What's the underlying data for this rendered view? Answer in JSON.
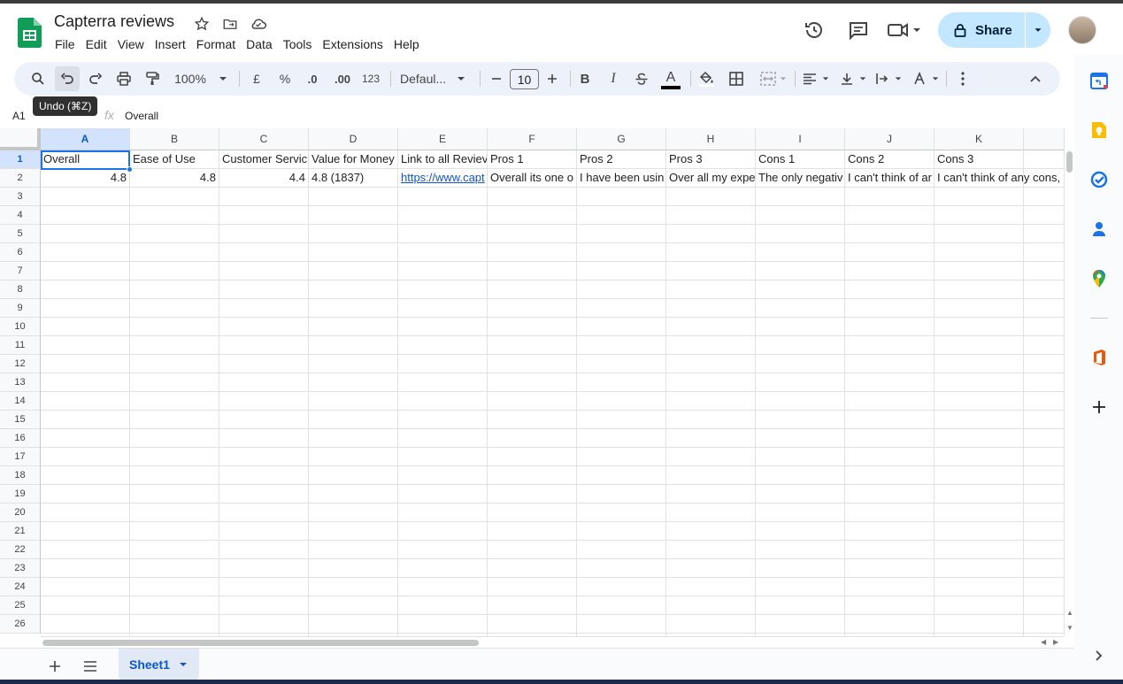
{
  "document": {
    "title": "Capterra reviews"
  },
  "menu": [
    "File",
    "Edit",
    "View",
    "Insert",
    "Format",
    "Data",
    "Tools",
    "Extensions",
    "Help"
  ],
  "header": {
    "share_label": "Share"
  },
  "toolbar": {
    "zoom": "100%",
    "currency": "£",
    "percent": "%",
    "decrease_decimals": ".0",
    "increase_decimals": ".00",
    "number_format": "123",
    "font": "Defaul...",
    "font_size": "10",
    "bold": "B",
    "italic": "I",
    "text_color_letter": "A"
  },
  "tooltip": "Undo (⌘Z)",
  "formula_bar": {
    "name_box": "A1",
    "fx": "fx",
    "value": "Overall"
  },
  "grid": {
    "columns": [
      "A",
      "B",
      "C",
      "D",
      "E",
      "F",
      "G",
      "H",
      "I",
      "J",
      "K"
    ],
    "rows": [
      "1",
      "2",
      "3",
      "4",
      "5",
      "6",
      "7",
      "8",
      "9",
      "10",
      "11",
      "12",
      "13",
      "14",
      "15",
      "16",
      "17",
      "18",
      "19",
      "20",
      "21",
      "22",
      "23",
      "24",
      "25",
      "26"
    ],
    "row1": [
      "Overall",
      "Ease of Use",
      "Customer Servic",
      "Value for Money",
      "Link to all Reviev",
      "Pros 1",
      "Pros 2",
      "Pros 3",
      "Cons 1",
      "Cons 2",
      "Cons 3"
    ],
    "row2": [
      "4.8",
      "4.8",
      "4.4",
      "4.8 (1837)",
      "https://www.capt",
      "Overall its one o",
      "I have been usin",
      "Over all my expe",
      "The only negativ",
      "I can't think of ar",
      "I can't think of any cons,"
    ]
  },
  "sheets": {
    "active": "Sheet1"
  },
  "colors": {
    "accent": "#0b57d0",
    "share_bg": "#c2e7ff",
    "selection": "#1a73e8",
    "toolbar_bg": "#edf2fa"
  }
}
